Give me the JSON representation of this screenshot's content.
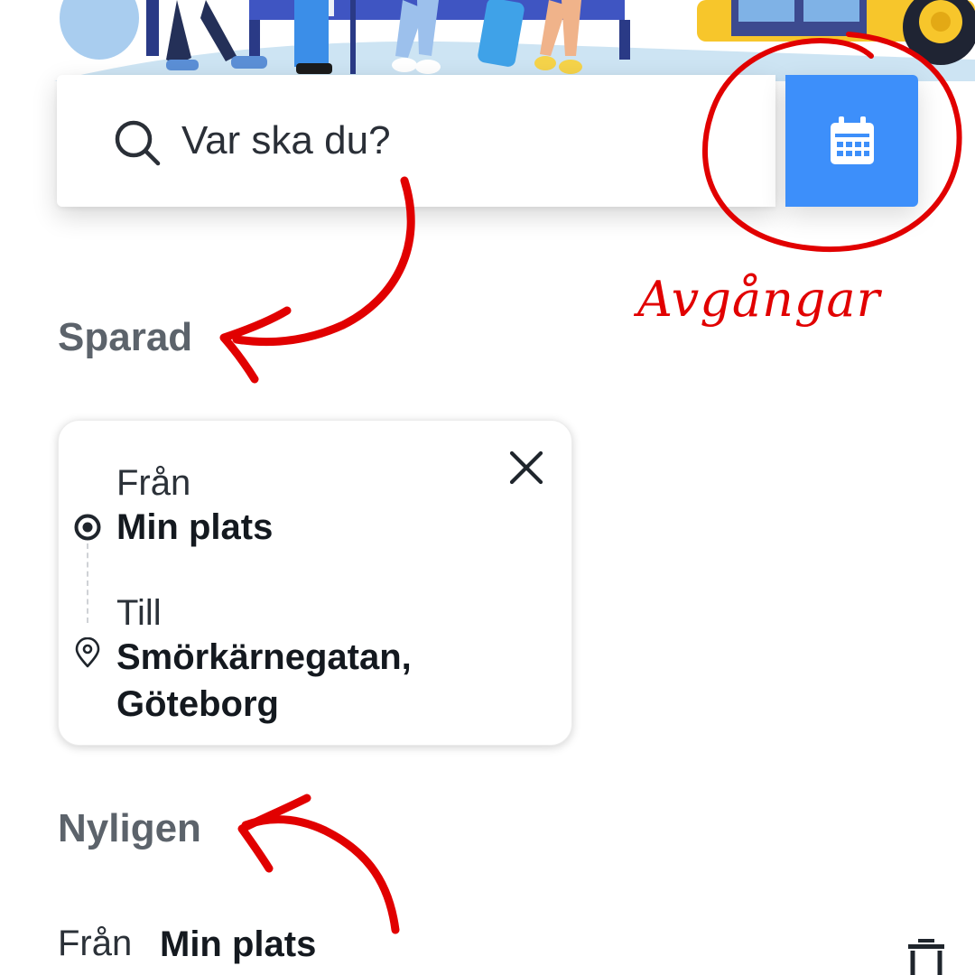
{
  "search": {
    "placeholder": "Var ska du?"
  },
  "sections": {
    "saved_title": "Sparad",
    "recent_title": "Nyligen"
  },
  "saved_trip": {
    "from_label": "Från",
    "from_value": "Min plats",
    "to_label": "Till",
    "to_value_line1": "Smörkärnegatan,",
    "to_value_line2": "Göteborg"
  },
  "recent_trip": {
    "from_label": "Från",
    "from_value": "Min plats"
  },
  "annotation": {
    "departures_text": "Avgångar"
  },
  "icons": {
    "search": "search-icon",
    "calendar": "calendar-icon",
    "close": "close-icon",
    "origin": "target-icon",
    "destination": "map-pin-icon",
    "trash": "trash-icon"
  },
  "colors": {
    "accent": "#3d8ffa",
    "annotation": "#e10000",
    "heading": "#5c636b"
  }
}
